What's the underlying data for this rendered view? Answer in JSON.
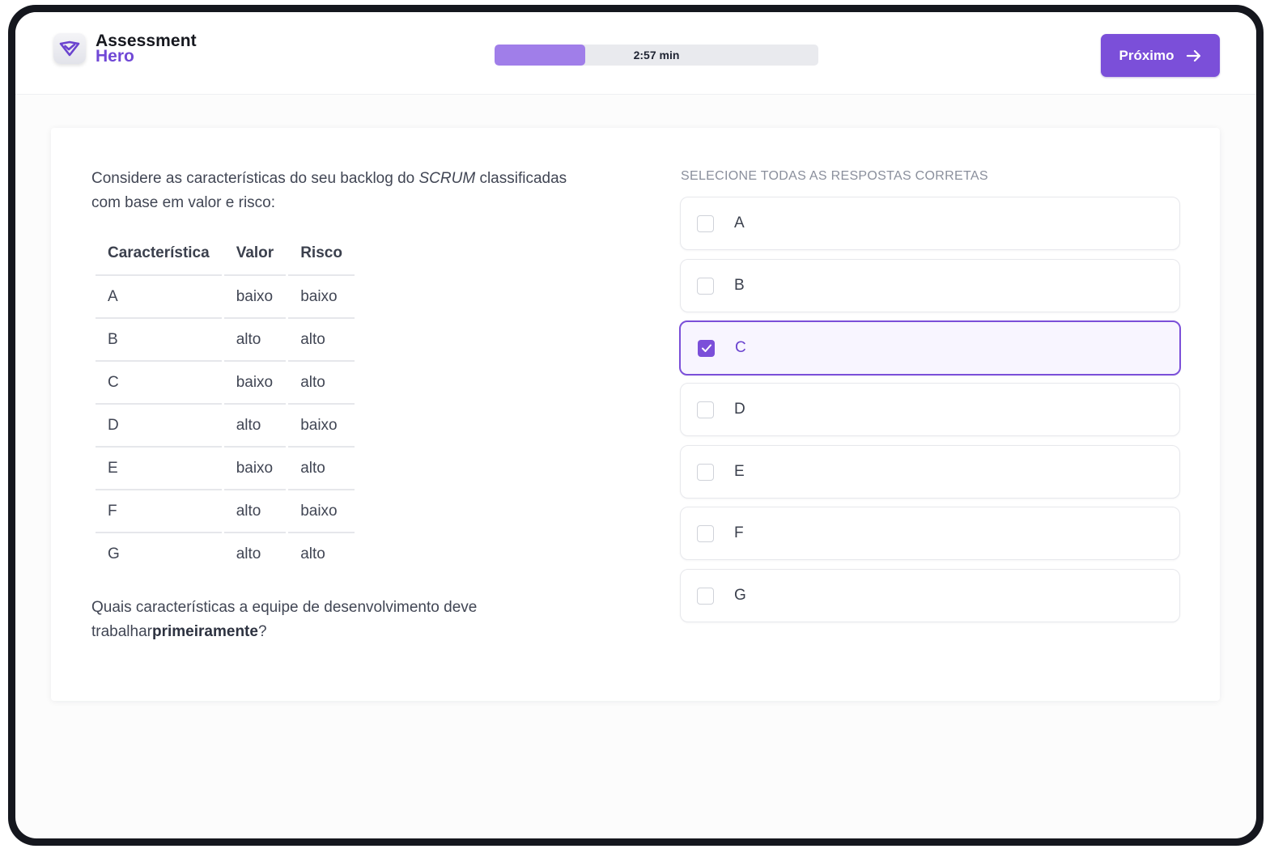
{
  "app": {
    "logo_line1": "Assessment",
    "logo_line2": "Hero",
    "brand_color": "#7b4fd9"
  },
  "header": {
    "timer_label": "2:57 min",
    "progress_fraction": 0.28,
    "next_label": "Próximo"
  },
  "question": {
    "intro_part1": "Considere as características do seu backlog do ",
    "intro_emph": "SCRUM",
    "intro_part2": " classificadas com base em valor e risco:",
    "table": {
      "headers": [
        "Característica",
        "Valor",
        "Risco"
      ],
      "rows": [
        [
          "A",
          "baixo",
          "baixo"
        ],
        [
          "B",
          "alto",
          "alto"
        ],
        [
          "C",
          "baixo",
          "alto"
        ],
        [
          "D",
          "alto",
          "baixo"
        ],
        [
          "E",
          "baixo",
          "alto"
        ],
        [
          "F",
          "alto",
          "baixo"
        ],
        [
          "G",
          "alto",
          "alto"
        ]
      ]
    },
    "outro_part1": "Quais características a equipe de desenvolvimento deve trabalhar",
    "outro_strong": "primeiramente",
    "outro_part2": "?"
  },
  "answers": {
    "instruction": "SELECIONE TODAS AS RESPOSTAS CORRETAS",
    "options": [
      {
        "label": "A",
        "checked": false
      },
      {
        "label": "B",
        "checked": false
      },
      {
        "label": "C",
        "checked": true
      },
      {
        "label": "D",
        "checked": false
      },
      {
        "label": "E",
        "checked": false
      },
      {
        "label": "F",
        "checked": false
      },
      {
        "label": "G",
        "checked": false
      }
    ]
  }
}
